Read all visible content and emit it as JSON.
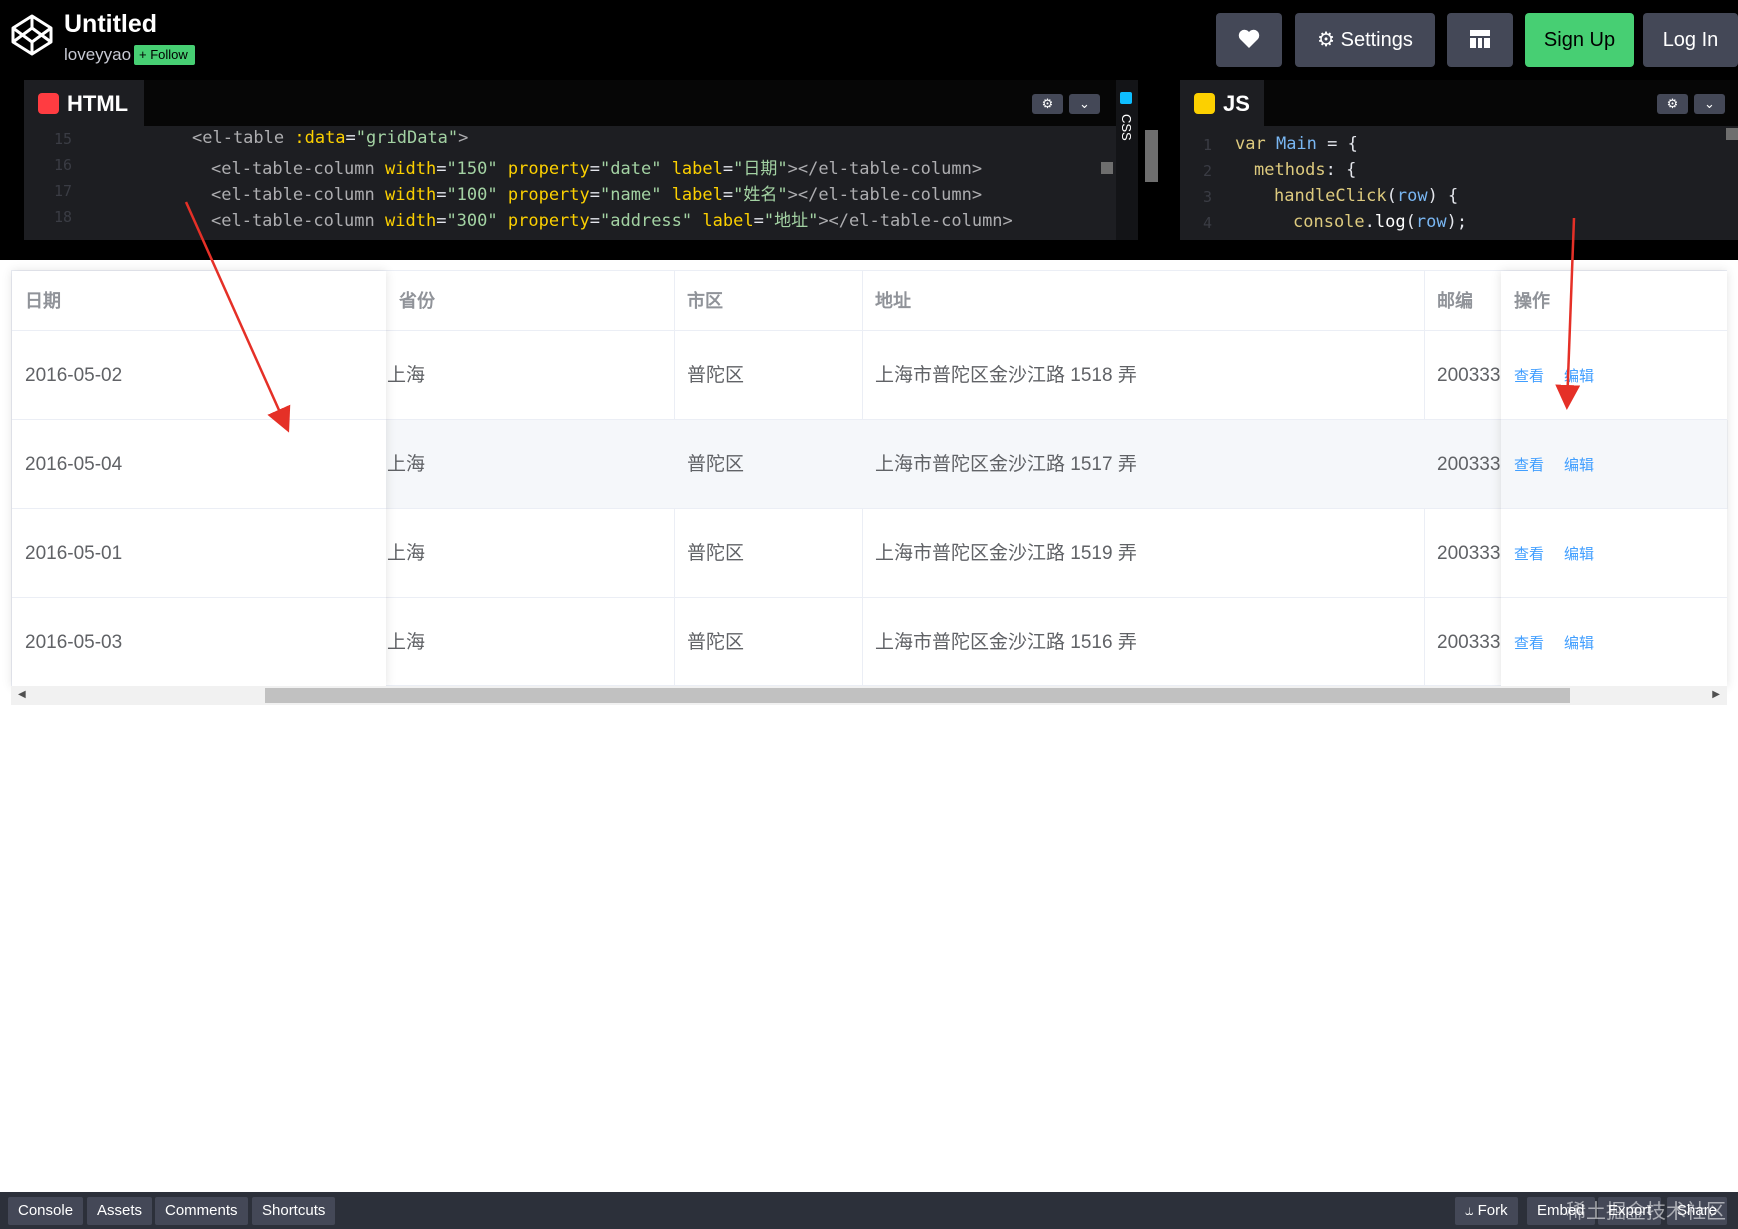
{
  "header": {
    "title": "Untitled",
    "user": "loveyyao",
    "follow_label": "+ Follow",
    "settings_label": "Settings",
    "signup_label": "Sign Up",
    "login_label": "Log In"
  },
  "editors": {
    "html_tab": "HTML",
    "css_tab": "CSS",
    "js_tab": "JS",
    "html_lines": [
      {
        "n": "15",
        "text": "<el-table :data=\"gridData\">"
      },
      {
        "n": "16",
        "text": "<el-table-column width=\"150\" property=\"date\" label=\"日期\"></el-table-column>"
      },
      {
        "n": "17",
        "text": "<el-table-column width=\"100\" property=\"name\" label=\"姓名\"></el-table-column>"
      },
      {
        "n": "18",
        "text": "<el-table-column width=\"300\" property=\"address\" label=\"地址\"></el-table-column>"
      }
    ],
    "js_lines": [
      {
        "n": "1",
        "text": "var Main = {"
      },
      {
        "n": "2",
        "text": "methods: {"
      },
      {
        "n": "3",
        "text": "handleClick(row) {"
      },
      {
        "n": "4",
        "text": "console.log(row);"
      }
    ]
  },
  "table": {
    "headers": [
      "日期",
      "省份",
      "市区",
      "地址",
      "邮编",
      "操作"
    ],
    "view_label": "查看",
    "edit_label": "编辑",
    "rows": [
      {
        "date": "2016-05-02",
        "province": "上海",
        "city": "普陀区",
        "address": "上海市普陀区金沙江路 1518 弄",
        "zip": "200333"
      },
      {
        "date": "2016-05-04",
        "province": "上海",
        "city": "普陀区",
        "address": "上海市普陀区金沙江路 1517 弄",
        "zip": "200333"
      },
      {
        "date": "2016-05-01",
        "province": "上海",
        "city": "普陀区",
        "address": "上海市普陀区金沙江路 1519 弄",
        "zip": "200333"
      },
      {
        "date": "2016-05-03",
        "province": "上海",
        "city": "普陀区",
        "address": "上海市普陀区金沙江路 1516 弄",
        "zip": "200333"
      }
    ]
  },
  "footer": {
    "console": "Console",
    "assets": "Assets",
    "comments": "Comments",
    "shortcuts": "Shortcuts",
    "fork": "Fork",
    "embed": "Embed",
    "export": "Export",
    "share": "Share",
    "watermark": "稀土掘金技术社区"
  },
  "colors": {
    "accent": "#47cf73",
    "link": "#409eff",
    "annotation_arrow": "#e53027"
  }
}
